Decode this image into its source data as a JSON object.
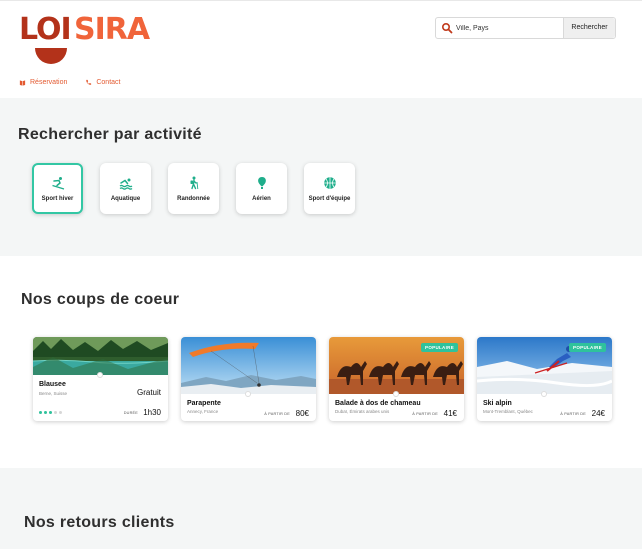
{
  "brand": {
    "part1": "LOI",
    "part2": "SIRA",
    "color_dark": "#b3321a",
    "color_light": "#f0643a"
  },
  "search": {
    "placeholder": "Ville, Pays",
    "button_label": "Rechercher"
  },
  "nav": [
    {
      "label": "Réservation",
      "icon": "book-icon"
    },
    {
      "label": "Contact",
      "icon": "phone-icon"
    }
  ],
  "activities": {
    "title": "Rechercher par activité",
    "items": [
      {
        "label": "Sport hiver",
        "icon": "skier-icon",
        "active": true
      },
      {
        "label": "Aquatique",
        "icon": "swimmer-icon",
        "active": false
      },
      {
        "label": "Randonnée",
        "icon": "hiker-icon",
        "active": false
      },
      {
        "label": "Aérien",
        "icon": "hot-air-balloon-icon",
        "active": false
      },
      {
        "label": "Sport d'équipe",
        "icon": "ball-icon",
        "active": false
      }
    ]
  },
  "favorites": {
    "title": "Nos coups de coeur",
    "cards": [
      {
        "name": "Blausee",
        "location": "Berne, Suisse",
        "price_label": "Gratuit",
        "duration_prefix": "DURÉE",
        "duration": "1h30",
        "rating": 3,
        "rating_max": 5,
        "badge": ""
      },
      {
        "name": "Parapente",
        "location": "Annecy, France",
        "price_prefix": "À PARTIR DE",
        "price": "80€",
        "badge": ""
      },
      {
        "name": "Balade à dos de chameau",
        "location": "Dubaï, Émirats arabes unis",
        "price_prefix": "À PARTIR DE",
        "price": "41€",
        "badge": "POPULAIRE"
      },
      {
        "name": "Ski alpin",
        "location": "Mont-Tremblant, Québec",
        "price_prefix": "À PARTIR DE",
        "price": "24€",
        "badge": "POPULAIRE"
      }
    ]
  },
  "reviews": {
    "title": "Nos retours clients"
  },
  "accent": "#2fc29c"
}
